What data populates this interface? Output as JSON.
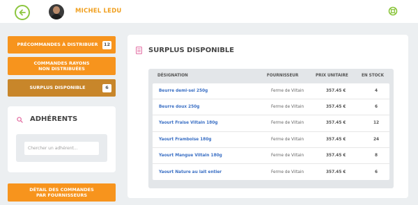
{
  "header": {
    "user_name": "MICHEL LEDU",
    "back_icon": "arrow-left-icon",
    "help_icon": "lifebuoy-icon",
    "accent_color": "#8cc63f"
  },
  "sidebar": {
    "buttons": [
      {
        "label": "PRÉCOMMANDES À DISTRIBUER",
        "count": "12",
        "color": "#f7941d"
      },
      {
        "label": "COMMANDES RAYONS\nNON DISTRIBUÉES",
        "color": "#f7941d"
      },
      {
        "label": "SURPLUS DISPONIBLE",
        "count": "6",
        "color": "#c8862a",
        "active": true
      },
      {
        "label": "DÉTAIL DES COMMANDES\nPAR FOURNISSEURS",
        "color": "#f7941d"
      }
    ],
    "adherents": {
      "title": "ADHÉRENTS",
      "search_placeholder": "Chercher un adhérent..."
    }
  },
  "main": {
    "title": "SURPLUS DISPONIBLE",
    "columns": [
      "DÉSIGNATION",
      "FOURNISSEUR",
      "PRIX UNITAIRE",
      "EN STOCK"
    ],
    "rows": [
      {
        "name": "Beurre demi-sel 250g",
        "supplier": "Ferme de Viltain",
        "price": "357.45 €",
        "stock": "4"
      },
      {
        "name": "Beurre doux 250g",
        "supplier": "Ferme de Viltain",
        "price": "357.45 €",
        "stock": "6"
      },
      {
        "name": "Yaourt Fraise Viltain 180g",
        "supplier": "Ferme de Viltain",
        "price": "357.45 €",
        "stock": "12"
      },
      {
        "name": "Yaourt Framboise 180g",
        "supplier": "Ferme de Viltain",
        "price": "357.45 €",
        "stock": "24"
      },
      {
        "name": "Yaourt Mangue Viltain 180g",
        "supplier": "Ferme de Viltain",
        "price": "357.45 €",
        "stock": "8"
      },
      {
        "name": "Yaourt Nature au lait entier",
        "supplier": "Ferme de Viltain",
        "price": "357.45 €",
        "stock": "6"
      }
    ]
  }
}
